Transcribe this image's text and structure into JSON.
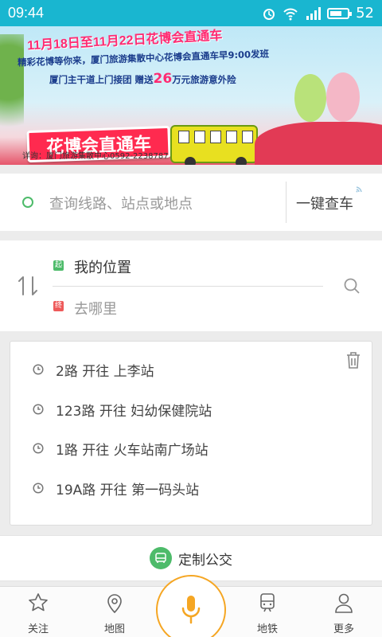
{
  "status_bar": {
    "time": "09:44",
    "battery": "52",
    "network": "4G"
  },
  "banner": {
    "headline": "11月18日至11月22日花博会直通车",
    "line2": "精彩花博等你来，厦门旅游集散中心花博会直通车早9:00发班",
    "line3_prefix": "厦门主干道上门接团 赠送",
    "line3_amount": "26",
    "line3_suffix": "万元旅游意外险",
    "badge": "花博会直通车",
    "bus_text": "花博会直通车",
    "consult": "详询：厦门旅游集散中心0592-2238787"
  },
  "search": {
    "placeholder": "查询线路、站点或地点",
    "quick_label": "一键查车"
  },
  "route": {
    "start_tag": "起",
    "end_tag": "终",
    "from": "我的位置",
    "to": "去哪里"
  },
  "history": [
    "2路 开往 上李站",
    "123路 开往 妇幼保健院站",
    "1路 开往 火车站南广场站",
    "19A路 开往 第一码头站"
  ],
  "custom_bus": {
    "label": "定制公交"
  },
  "nav": [
    {
      "label": "关注",
      "icon": "star-icon"
    },
    {
      "label": "地图",
      "icon": "map-pin-icon"
    },
    {
      "label": "地铁",
      "icon": "subway-icon"
    },
    {
      "label": "更多",
      "icon": "user-icon"
    }
  ],
  "colors": {
    "status_bar": "#19b6d0",
    "accent_green": "#4dbb6a",
    "accent_orange": "#f5a623",
    "end_red": "#ee5a5a"
  }
}
